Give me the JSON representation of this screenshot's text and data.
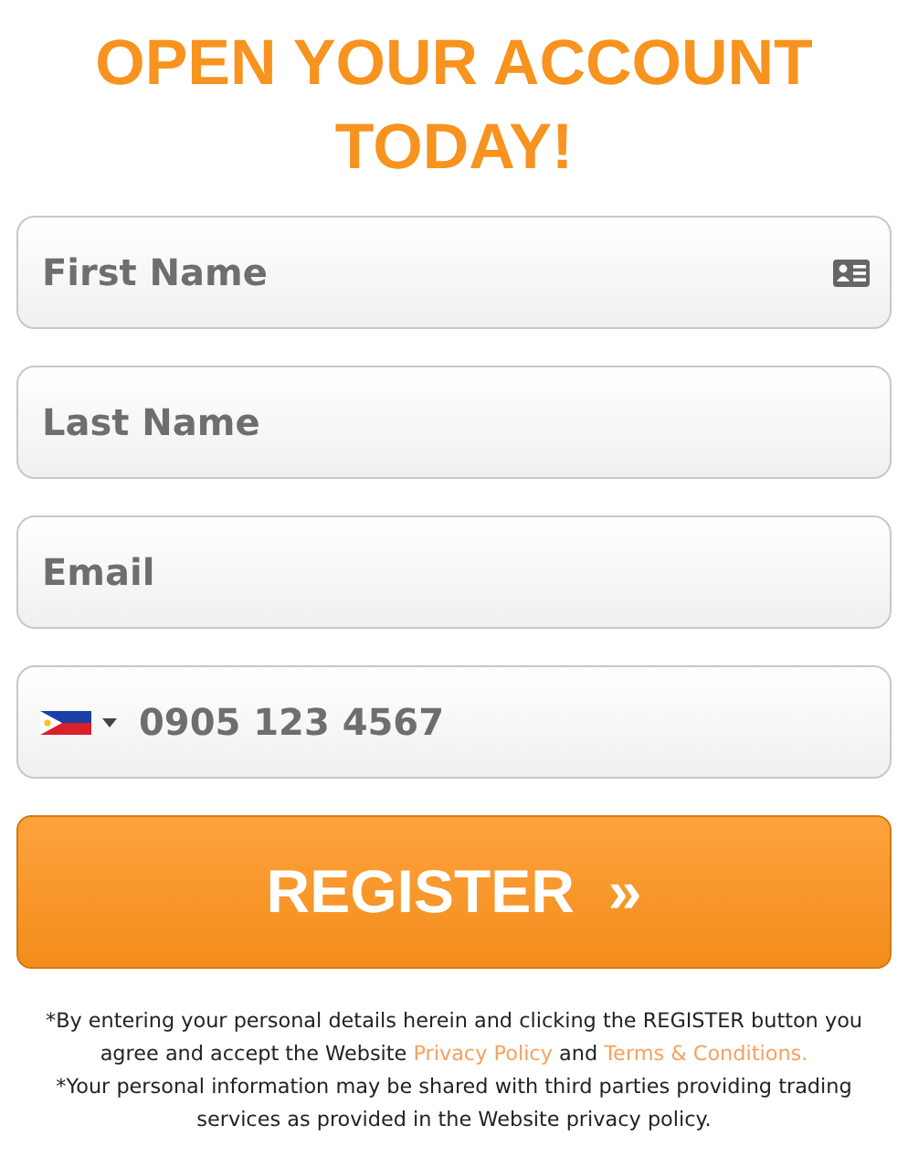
{
  "title": "OPEN YOUR ACCOUNT TODAY!",
  "fields": [
    {
      "kind": "text",
      "placeholder": "First Name",
      "icon": true
    },
    {
      "kind": "text",
      "placeholder": "Last Name",
      "icon": false
    },
    {
      "kind": "text",
      "placeholder": "Email",
      "icon": false
    },
    {
      "kind": "phone",
      "placeholder": "0905 123 4567",
      "icon": false
    }
  ],
  "register_button": {
    "label": "REGISTER",
    "arrow": "»"
  },
  "disclaimer": {
    "before": "*By entering your personal details herein and clicking the REGISTER button you agree and accept the Website ",
    "link_1": "Privacy Policy",
    "middle": " and ",
    "link_2": "Terms & Conditions.",
    "note": "*Your personal information may be shared with third parties providing trading services as provided in the Website privacy policy."
  }
}
